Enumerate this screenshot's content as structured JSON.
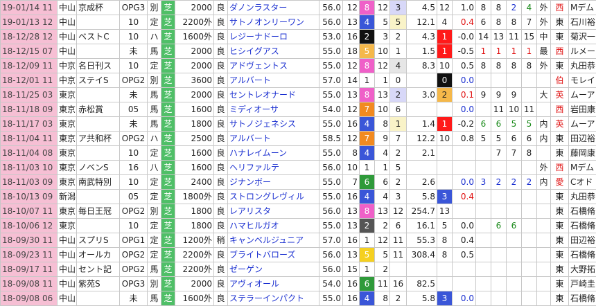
{
  "rows": [
    {
      "d": "19-01/14 11",
      "v": "中山",
      "r": "京成杯",
      "g": "OPG3",
      "c": "別",
      "s": "芝",
      "dist": "2000",
      "go": "良",
      "h": "ダノンラスター",
      "w": "56.0",
      "n": "12",
      "f": "8",
      "fc": "#ef60c8",
      "p": "12",
      "pop": "3",
      "pc": "#d8d8f8",
      "o": "4.5",
      "fin": "12",
      "t": "1.0",
      "a": "8",
      "b": "8",
      "e": "2",
      "cc": "blue",
      "ff": "4",
      "fc2": "green",
      "m": "外",
      "k": "西",
      "kc": "#e01010",
      "j": "Mデム"
    },
    {
      "d": "19-01/13 12",
      "v": "中山",
      "r": "",
      "g": "10",
      "c": "定",
      "s": "芝",
      "dist": "2200外",
      "go": "良",
      "h": "サトノオンリーワン",
      "w": "56.0",
      "n": "13",
      "f": "4",
      "fc": "#3a56d8",
      "p": "5",
      "pop": "5",
      "pc": "#f9f3c8",
      "o": "12.1",
      "fin": "4",
      "t": "0.4",
      "tc": "red",
      "a": "6",
      "b": "8",
      "e": "8",
      "cc": "",
      "ff": "7",
      "fc2": "",
      "m": "外",
      "k": "東",
      "kc": "#111",
      "j": "石川裕"
    },
    {
      "d": "18-12/28 12",
      "v": "中山",
      "r": "ベストC",
      "g": "10",
      "c": "ハ",
      "s": "芝",
      "dist": "1600外",
      "go": "良",
      "h": "レジーナドーロ",
      "w": "53.0",
      "n": "16",
      "f": "2",
      "fc": "#111",
      "p": "3",
      "pop": "2",
      "pc": "",
      "o": "4.3",
      "fin": "1",
      "finbg": "rbg",
      "t": "-0.0",
      "a": "14",
      "b": "13",
      "e": "11",
      "cc": "",
      "ff": "15",
      "fc2": "",
      "m": "中",
      "k": "東",
      "kc": "#111",
      "j": "菊沢一"
    },
    {
      "d": "18-12/15 07",
      "v": "中山",
      "r": "",
      "g": "未",
      "c": "馬",
      "s": "芝",
      "dist": "2000",
      "go": "良",
      "h": "ヒシイグアス",
      "w": "55.0",
      "n": "18",
      "f": "5",
      "fc": "#f5b84a",
      "p": "10",
      "pop": "1",
      "pc": "",
      "o": "1.5",
      "fin": "1",
      "finbg": "rbg",
      "t": "-0.5",
      "a": "1",
      "ac": "red",
      "b": "1",
      "bc": "red",
      "e": "1",
      "cc": "red",
      "ff": "1",
      "fc2": "red",
      "m": "最",
      "k": "西",
      "kc": "#e01010",
      "j": "ルメー"
    },
    {
      "d": "18-12/09 11",
      "v": "中京",
      "r": "名日刊ス",
      "g": "10",
      "c": "定",
      "s": "芝",
      "dist": "2000",
      "go": "良",
      "h": "アドヴェントス",
      "w": "55.0",
      "n": "12",
      "f": "8",
      "fc": "#ef60c8",
      "p": "12",
      "pop": "4",
      "pc": "#e6e6e6",
      "o": "8.3",
      "fin": "10",
      "t": "0.5",
      "a": "8",
      "b": "8",
      "e": "8",
      "cc": "",
      "ff": "8",
      "fc2": "",
      "m": "外",
      "k": "東",
      "kc": "#111",
      "j": "丸田恭"
    },
    {
      "d": "18-12/01 11",
      "v": "中京",
      "r": "ステイS",
      "g": "OPG2",
      "c": "別",
      "s": "芝",
      "dist": "3600",
      "go": "良",
      "h": "アルバート",
      "w": "57.0",
      "n": "14",
      "f": "1",
      "fc": "",
      "p": "1",
      "pop": "0",
      "pc": "",
      "o": "",
      "fin": "0",
      "finbg": "kbg",
      "t": "0.0",
      "tc": "blue",
      "a": "",
      "b": "",
      "e": "",
      "cc": "",
      "ff": "",
      "fc2": "",
      "m": "",
      "k": "伯",
      "kc": "#e01010",
      "j": "モレイ"
    },
    {
      "d": "18-11/25 03",
      "v": "東京",
      "r": "",
      "g": "未",
      "c": "馬",
      "s": "芝",
      "dist": "2000",
      "go": "良",
      "h": "セントレオナード",
      "w": "55.0",
      "n": "13",
      "f": "8",
      "fc": "#ef60c8",
      "p": "13",
      "pop": "2",
      "pc": "#d8d8f8",
      "o": "3.0",
      "fin": "2",
      "finbg": "obg",
      "t": "0.1",
      "tc": "red",
      "a": "9",
      "b": "9",
      "e": "9",
      "cc": "",
      "ff": "",
      "fc2": "",
      "m": "大",
      "k": "英",
      "kc": "#e01010",
      "j": "ムーア"
    },
    {
      "d": "18-11/18 09",
      "v": "東京",
      "r": "赤松賞",
      "g": "05",
      "c": "馬",
      "s": "芝",
      "dist": "1600",
      "go": "良",
      "h": "ミディオーサ",
      "w": "54.0",
      "n": "12",
      "f": "7",
      "fc": "#f28a20",
      "p": "10",
      "pop": "6",
      "pc": "",
      "o": "",
      "fin": "",
      "t": "0.0",
      "tc": "blue",
      "a": "",
      "b": "11",
      "e": "10",
      "cc": "",
      "ff": "11",
      "fc2": "",
      "m": "",
      "k": "西",
      "kc": "#e01010",
      "j": "岩田康"
    },
    {
      "d": "18-11/17 03",
      "v": "東京",
      "r": "",
      "g": "未",
      "c": "馬",
      "s": "芝",
      "dist": "1800",
      "go": "良",
      "h": "サトノジェネシス",
      "w": "55.0",
      "n": "16",
      "f": "4",
      "fc": "#3a56d8",
      "p": "8",
      "pop": "1",
      "pc": "#f9f3c8",
      "o": "1.4",
      "fin": "1",
      "finbg": "rbg",
      "t": "-0.2",
      "a": "6",
      "ac": "green",
      "b": "6",
      "bc": "green",
      "e": "5",
      "cc": "green",
      "ff": "5",
      "fc2": "green",
      "m": "内",
      "k": "英",
      "kc": "#e01010",
      "j": "ムーア"
    },
    {
      "d": "18-11/04 11",
      "v": "東京",
      "r": "ア共和杯",
      "g": "OPG2",
      "c": "ハ",
      "s": "芝",
      "dist": "2500",
      "go": "良",
      "h": "アルバート",
      "w": "58.5",
      "n": "12",
      "f": "7",
      "fc": "#f28a20",
      "p": "9",
      "pop": "7",
      "pc": "",
      "o": "12.2",
      "fin": "10",
      "t": "0.8",
      "a": "5",
      "b": "5",
      "e": "6",
      "cc": "",
      "ff": "6",
      "fc2": "",
      "m": "内",
      "k": "東",
      "kc": "#111",
      "j": "田辺裕"
    },
    {
      "d": "18-11/04 08",
      "v": "東京",
      "r": "",
      "g": "10",
      "c": "定",
      "s": "芝",
      "dist": "1600",
      "go": "良",
      "h": "ハナレイムーン",
      "w": "55.0",
      "n": "8",
      "f": "4",
      "fc": "#3a56d8",
      "p": "4",
      "pop": "2",
      "pc": "",
      "o": "2.1",
      "fin": "",
      "t": "",
      "a": "",
      "b": "7",
      "e": "7",
      "cc": "",
      "ff": "8",
      "fc2": "",
      "m": "",
      "k": "東",
      "kc": "#111",
      "j": "藤岡康"
    },
    {
      "d": "18-11/03 10",
      "v": "東京",
      "r": "ノベンS",
      "g": "16",
      "c": "八",
      "s": "芝",
      "dist": "1600",
      "go": "良",
      "h": "ヘリファルテ",
      "w": "56.0",
      "n": "10",
      "f": "1",
      "fc": "",
      "p": "1",
      "pop": "5",
      "pc": "",
      "o": "",
      "fin": "",
      "t": "",
      "a": "",
      "b": "",
      "e": "",
      "cc": "",
      "ff": "",
      "fc2": "",
      "m": "外",
      "k": "西",
      "kc": "#e01010",
      "j": "Mデム"
    },
    {
      "d": "18-11/03 09",
      "v": "東京",
      "r": "南武特別",
      "g": "10",
      "c": "定",
      "s": "芝",
      "dist": "2400",
      "go": "良",
      "h": "ジナンボー",
      "w": "55.0",
      "n": "7",
      "f": "6",
      "fc": "#2f9a3a",
      "p": "6",
      "pop": "2",
      "pc": "",
      "o": "2.6",
      "fin": "",
      "t": "0.0",
      "tc": "blue",
      "a": "3",
      "ac": "blue",
      "b": "2",
      "bc": "blue",
      "e": "2",
      "cc": "blue",
      "ff": "2",
      "fc2": "blue",
      "m": "内",
      "k": "愛",
      "kc": "#e01010",
      "j": "Cオド"
    },
    {
      "d": "18-10/13 09",
      "v": "新潟",
      "r": "",
      "g": "05",
      "c": "定",
      "s": "芝",
      "dist": "1800外",
      "go": "良",
      "h": "ストロングレヴィル",
      "w": "55.0",
      "n": "16",
      "f": "4",
      "fc": "#3a56d8",
      "p": "4",
      "pop": "3",
      "pc": "",
      "o": "5.8",
      "fin": "3",
      "finbg": "bbg",
      "t": "0.4",
      "tc": "red",
      "a": "",
      "b": "",
      "e": "",
      "cc": "",
      "ff": "",
      "fc2": "",
      "m": "",
      "k": "東",
      "kc": "#111",
      "j": "丸田恭"
    },
    {
      "d": "18-10/07 11",
      "v": "東京",
      "r": "毎日王冠",
      "g": "OPG2",
      "c": "別",
      "s": "芝",
      "dist": "1800",
      "go": "良",
      "h": "レアリスタ",
      "w": "56.0",
      "n": "13",
      "f": "8",
      "fc": "#ef60c8",
      "p": "13",
      "pop": "12",
      "pc": "",
      "o": "254.7",
      "fin": "13",
      "t": "",
      "a": "",
      "b": "",
      "e": "",
      "cc": "",
      "ff": "",
      "fc2": "",
      "m": "",
      "k": "東",
      "kc": "#111",
      "j": "石橋脩"
    },
    {
      "d": "18-10/06 12",
      "v": "東京",
      "r": "",
      "g": "10",
      "c": "定",
      "s": "芝",
      "dist": "1800",
      "go": "良",
      "h": "ハマヒルガオ",
      "w": "55.0",
      "n": "13",
      "f": "2",
      "fc": "#555",
      "p": "2",
      "pop": "6",
      "pc": "",
      "o": "16.1",
      "fin": "5",
      "t": "0.0",
      "tc": "",
      "a": "",
      "b": "6",
      "bc": "green",
      "e": "6",
      "cc": "green",
      "ff": "",
      "fc2": "",
      "m": "",
      "k": "東",
      "kc": "#111",
      "j": "石橋脩"
    },
    {
      "d": "18-09/30 11",
      "v": "中山",
      "r": "スプリS",
      "g": "OPG1",
      "c": "定",
      "s": "芝",
      "dist": "1200外",
      "go": "稍",
      "h": "キャンベルジュニア",
      "w": "57.0",
      "n": "16",
      "f": "1",
      "fc": "",
      "p": "12",
      "pop": "11",
      "pc": "",
      "o": "55.3",
      "fin": "8",
      "t": "0.4",
      "a": "",
      "b": "",
      "e": "",
      "cc": "",
      "ff": "",
      "fc2": "",
      "m": "",
      "k": "東",
      "kc": "#111",
      "j": "田辺裕"
    },
    {
      "d": "18-09/23 11",
      "v": "中山",
      "r": "オールカ",
      "g": "OPG2",
      "c": "定",
      "s": "芝",
      "dist": "2200外",
      "go": "良",
      "h": "ブライトバローズ",
      "w": "56.0",
      "n": "13",
      "f": "5",
      "fc": "#f5d020",
      "p": "5",
      "pop": "11",
      "pc": "",
      "o": "308.4",
      "fin": "8",
      "t": "0.5",
      "a": "",
      "b": "",
      "e": "",
      "cc": "",
      "ff": "",
      "fc2": "",
      "m": "",
      "k": "東",
      "kc": "#111",
      "j": "石橋脩"
    },
    {
      "d": "18-09/17 11",
      "v": "中山",
      "r": "セント記",
      "g": "OPG2",
      "c": "馬",
      "s": "芝",
      "dist": "2200外",
      "go": "良",
      "h": "ゼーゲン",
      "w": "56.0",
      "n": "15",
      "f": "1",
      "fc": "",
      "p": "2",
      "pop": "",
      "pc": "",
      "o": "",
      "fin": "",
      "t": "",
      "a": "",
      "b": "",
      "e": "",
      "cc": "",
      "ff": "",
      "fc2": "",
      "m": "",
      "k": "東",
      "kc": "#111",
      "j": "大野拓"
    },
    {
      "d": "18-09/08 11",
      "v": "中山",
      "r": "紫苑S",
      "g": "OPG3",
      "c": "別",
      "s": "芝",
      "dist": "2000",
      "go": "良",
      "h": "アヴィオール",
      "w": "54.0",
      "n": "16",
      "f": "6",
      "fc": "#2f9a3a",
      "p": "11",
      "pop": "16",
      "pc": "",
      "o": "82.5",
      "fin": "",
      "t": "",
      "a": "",
      "b": "",
      "e": "",
      "cc": "",
      "ff": "",
      "fc2": "",
      "m": "",
      "k": "東",
      "kc": "#111",
      "j": "戸崎圭"
    },
    {
      "d": "18-09/08 06",
      "v": "中山",
      "r": "",
      "g": "未",
      "c": "馬",
      "s": "芝",
      "dist": "1600外",
      "go": "良",
      "h": "ステラーインパクト",
      "w": "55.0",
      "n": "16",
      "f": "4",
      "fc": "#3a56d8",
      "p": "8",
      "pop": "2",
      "pc": "",
      "o": "5.8",
      "fin": "3",
      "finbg": "bbg",
      "t": "0.0",
      "tc": "blue",
      "a": "",
      "b": "",
      "e": "",
      "cc": "",
      "ff": "",
      "fc2": "",
      "m": "",
      "k": "東",
      "kc": "#111",
      "j": "石橋脩"
    }
  ]
}
